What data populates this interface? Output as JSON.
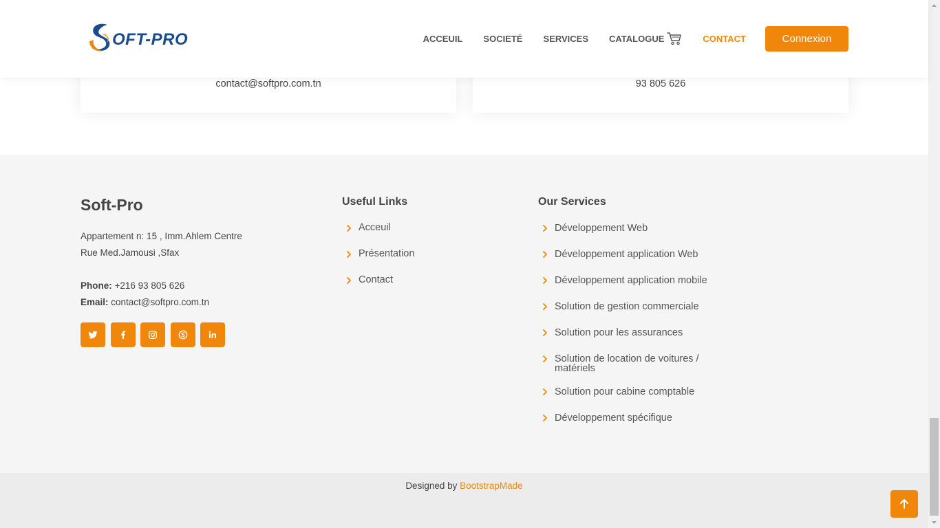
{
  "header": {
    "logo_text": "OFT-PRO",
    "nav": [
      {
        "label": "ACCEUIL",
        "active": false
      },
      {
        "label": "SOCIETÉ",
        "active": false
      },
      {
        "label": "SERVICES",
        "active": false
      },
      {
        "label": "CATALOGUE",
        "active": false
      },
      {
        "label": "CONTACT",
        "active": true
      }
    ],
    "login_label": "Connexion"
  },
  "cards": {
    "email": "contact@softpro.com.tn",
    "phone": "93 805 626"
  },
  "footer": {
    "brand": "Soft-Pro",
    "address_line1": "Appartement n: 15 , Imm.Ahlem Centre",
    "address_line2": "Rue Med.Jamousi ,Sfax",
    "phone_label": "Phone:",
    "phone_value": " +216 93 805 626",
    "email_label": "Email:",
    "email_value": " contact@softpro.com.tn",
    "socials": [
      "twitter-icon",
      "facebook-icon",
      "instagram-icon",
      "skype-icon",
      "linkedin-icon"
    ],
    "useful_links": {
      "title": "Useful Links",
      "items": [
        "Acceuil",
        "Présentation",
        "Contact"
      ]
    },
    "services": {
      "title": "Our Services",
      "items": [
        "Développement Web",
        "Développement application Web",
        "Développement application mobile",
        "Solution de gestion commerciale",
        "Solution pour les assurances",
        "Solution de location de voitures / matériels",
        "Solution pour cabine comptable",
        "Développement spécifique"
      ]
    }
  },
  "credits": {
    "prefix": "Designed by ",
    "link": "BootstrapMade"
  },
  "colors": {
    "accent": "#f0870a",
    "brand_blue": "#1a4b8e",
    "footer_bg": "#f5f5f5",
    "bottom_bg": "#ececec"
  }
}
